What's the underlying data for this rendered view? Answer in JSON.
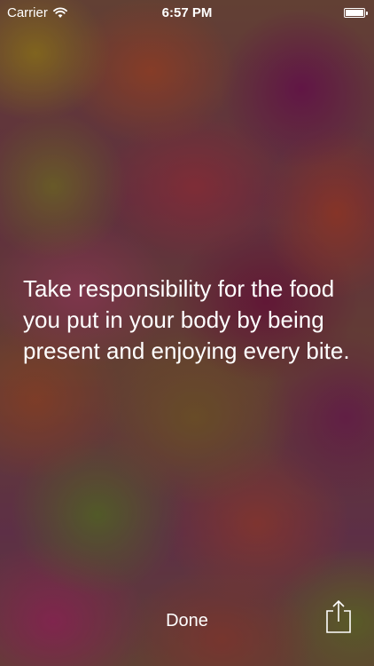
{
  "status_bar": {
    "carrier": "Carrier",
    "time": "6:57 PM",
    "wifi_icon": "wifi-icon",
    "battery_icon": "battery-icon"
  },
  "quote": {
    "text": "Take responsibility for the food you put in your body by being present and enjoying every bite."
  },
  "toolbar": {
    "done_label": "Done",
    "share_icon": "share-icon"
  },
  "colors": {
    "text": "#ffffff"
  }
}
